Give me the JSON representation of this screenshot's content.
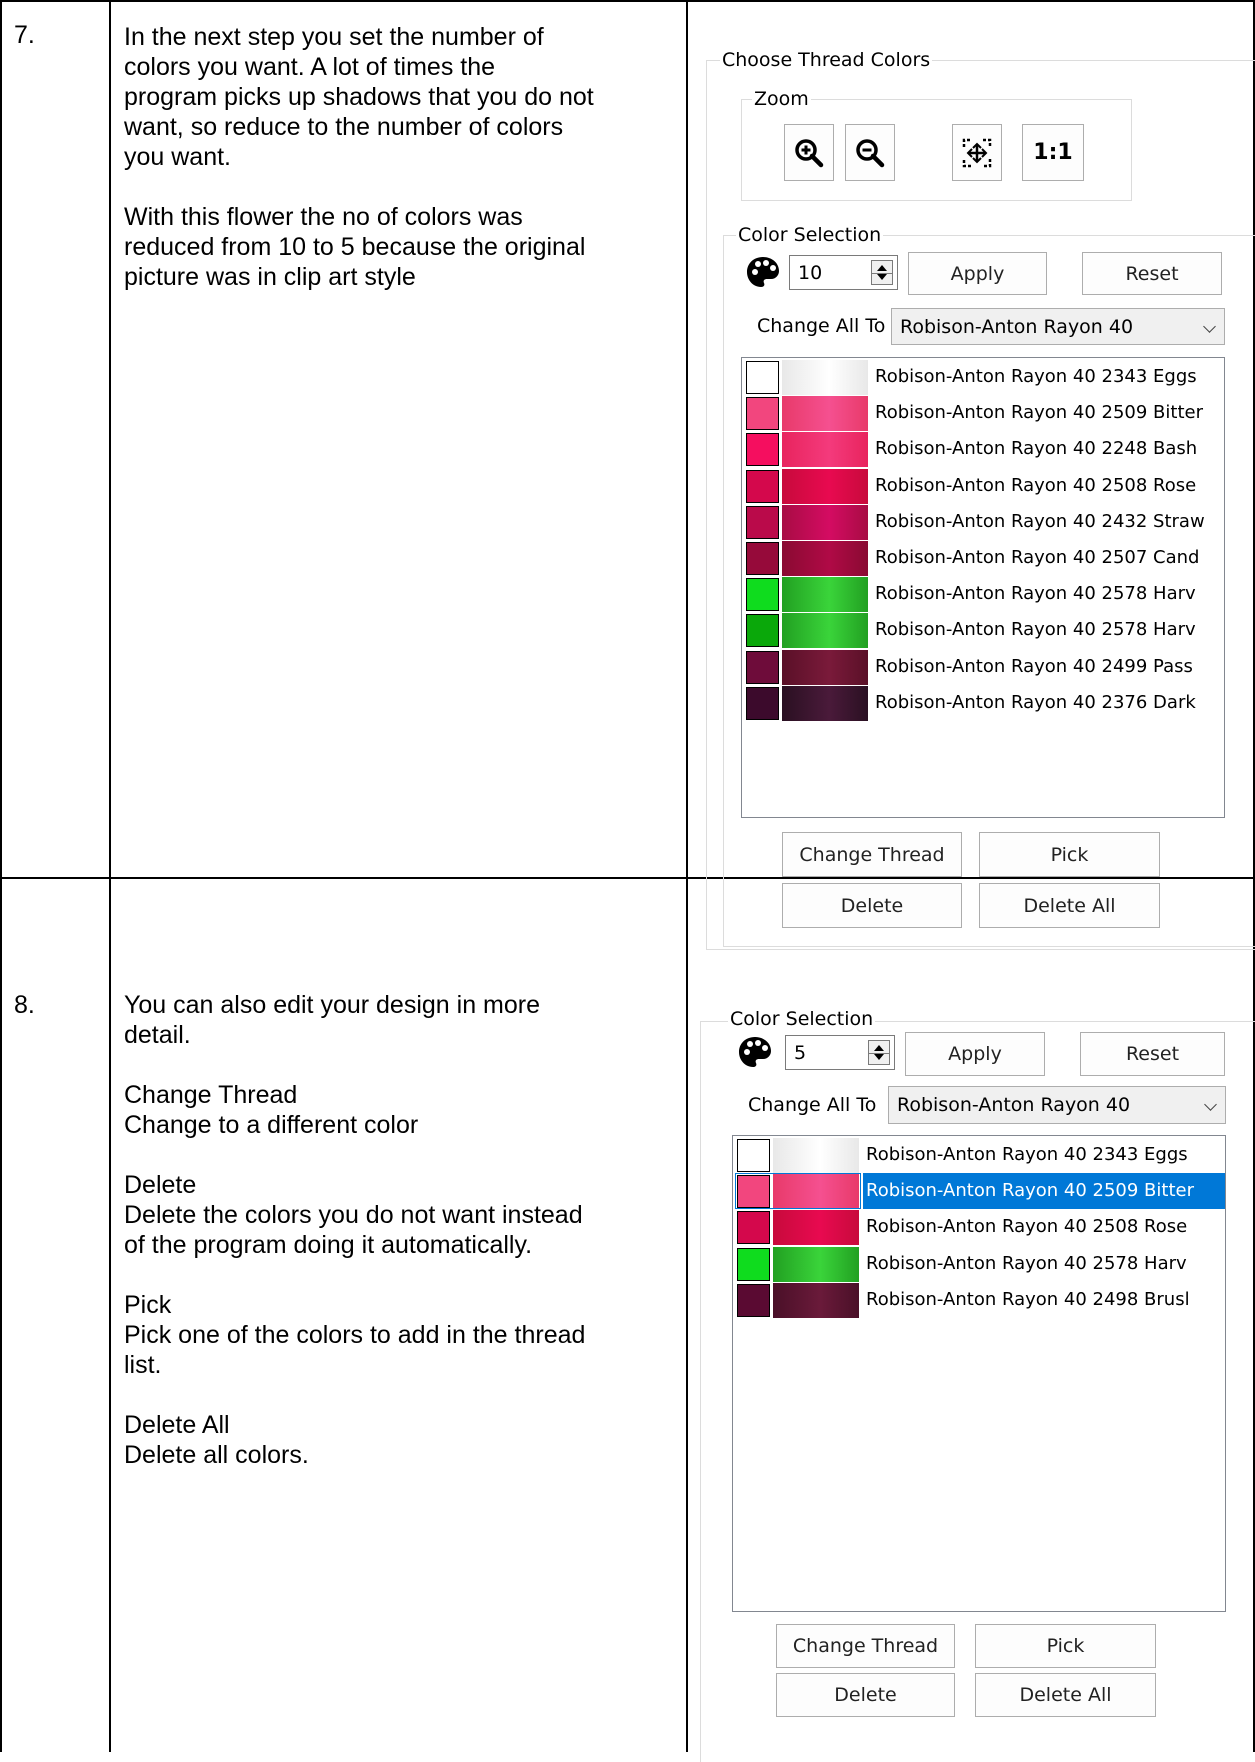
{
  "steps": [
    {
      "number": "7.",
      "paragraphs": [
        [
          "In the next step you set the number of",
          "colors you want. A lot of times the",
          "program picks up shadows that you do not",
          "want, so reduce to the number of colors",
          "you want."
        ],
        [
          "With this flower the no of colors was",
          "reduced from 10 to 5 because the original",
          "picture was in clip art style"
        ]
      ],
      "panel": {
        "outer_title": "Choose Thread Colors",
        "zoom_title": "Zoom",
        "zoom_buttons": [
          {
            "icon": "zoom-in-icon"
          },
          {
            "icon": "zoom-out-icon"
          },
          {
            "icon": "fit-to-window-icon"
          },
          {
            "icon": "actual-size-icon",
            "label": "1:1"
          }
        ],
        "color_selection_title": "Color Selection",
        "palette_icon": "palette-icon",
        "color_count": "10",
        "apply": "Apply",
        "reset": "Reset",
        "change_all_to_label": "Change All To",
        "change_all_to_value": "Robison-Anton Rayon 40",
        "threads": [
          {
            "name": "Robison-Anton Rayon 40 2343 Eggs",
            "swatch": "#ffffff",
            "g1": "#e8e8e8",
            "g2": "#ffffff"
          },
          {
            "name": "Robison-Anton Rayon 40 2509 Bitter",
            "swatch": "#f2467e",
            "g1": "#e83a6a",
            "g2": "#f55090"
          },
          {
            "name": "Robison-Anton Rayon 40 2248 Bash",
            "swatch": "#f50e5f",
            "g1": "#e8245e",
            "g2": "#f43a7c"
          },
          {
            "name": "Robison-Anton Rayon 40 2508 Rose",
            "swatch": "#d4084c",
            "g1": "#c80a3c",
            "g2": "#e80a50"
          },
          {
            "name": "Robison-Anton Rayon 40 2432 Straw",
            "swatch": "#ba0a4a",
            "g1": "#a80c44",
            "g2": "#d40c62"
          },
          {
            "name": "Robison-Anton Rayon 40 2507 Cand",
            "swatch": "#960a3a",
            "g1": "#8a0a32",
            "g2": "#b00a46"
          },
          {
            "name": "Robison-Anton Rayon 40 2578 Harv",
            "swatch": "#0fdc1e",
            "g1": "#22a022",
            "g2": "#3ad43a"
          },
          {
            "name": "Robison-Anton Rayon 40 2578 Harv",
            "swatch": "#0aa80a",
            "g1": "#22a022",
            "g2": "#3ad43a"
          },
          {
            "name": "Robison-Anton Rayon 40 2499 Pass",
            "swatch": "#6e0c3a",
            "g1": "#5a1028",
            "g2": "#7a1a3a"
          },
          {
            "name": "Robison-Anton Rayon 40 2376 Dark",
            "swatch": "#3c0a2c",
            "g1": "#2a1022",
            "g2": "#4a1a3a"
          }
        ],
        "buttons": {
          "change_thread": "Change Thread",
          "pick": "Pick",
          "delete": "Delete",
          "delete_all": "Delete All"
        }
      }
    },
    {
      "number": "8.",
      "paragraphs": [
        [
          "You can also edit your design in more",
          "detail."
        ],
        [
          "Change Thread",
          "Change to a different color"
        ],
        [
          "Delete",
          "Delete the colors you do not want instead",
          "of the program doing it automatically."
        ],
        [
          "Pick",
          "Pick one of the colors to add in the thread",
          "list."
        ],
        [
          "Delete All",
          "Delete all colors."
        ]
      ],
      "panel": {
        "color_selection_title": "Color Selection",
        "palette_icon": "palette-icon",
        "color_count": "5",
        "apply": "Apply",
        "reset": "Reset",
        "change_all_to_label": "Change All To",
        "change_all_to_value": "Robison-Anton Rayon 40",
        "threads": [
          {
            "name": "Robison-Anton Rayon 40 2343 Eggs",
            "swatch": "#ffffff",
            "g1": "#e8e8e8",
            "g2": "#ffffff"
          },
          {
            "name": "Robison-Anton Rayon 40 2509 Bitter",
            "swatch": "#f2467e",
            "g1": "#e83a6a",
            "g2": "#f55090",
            "selected": true
          },
          {
            "name": "Robison-Anton Rayon 40 2508 Rose",
            "swatch": "#d4084c",
            "g1": "#c80a3c",
            "g2": "#e80a50"
          },
          {
            "name": "Robison-Anton Rayon 40 2578 Harv",
            "swatch": "#0fdc1e",
            "g1": "#22a022",
            "g2": "#3ad43a"
          },
          {
            "name": "Robison-Anton Rayon 40 2498 Brusl",
            "swatch": "#5a0a32",
            "g1": "#4a1028",
            "g2": "#6a1a3a"
          }
        ],
        "buttons": {
          "change_thread": "Change Thread",
          "pick": "Pick",
          "delete": "Delete",
          "delete_all": "Delete All"
        }
      }
    }
  ]
}
